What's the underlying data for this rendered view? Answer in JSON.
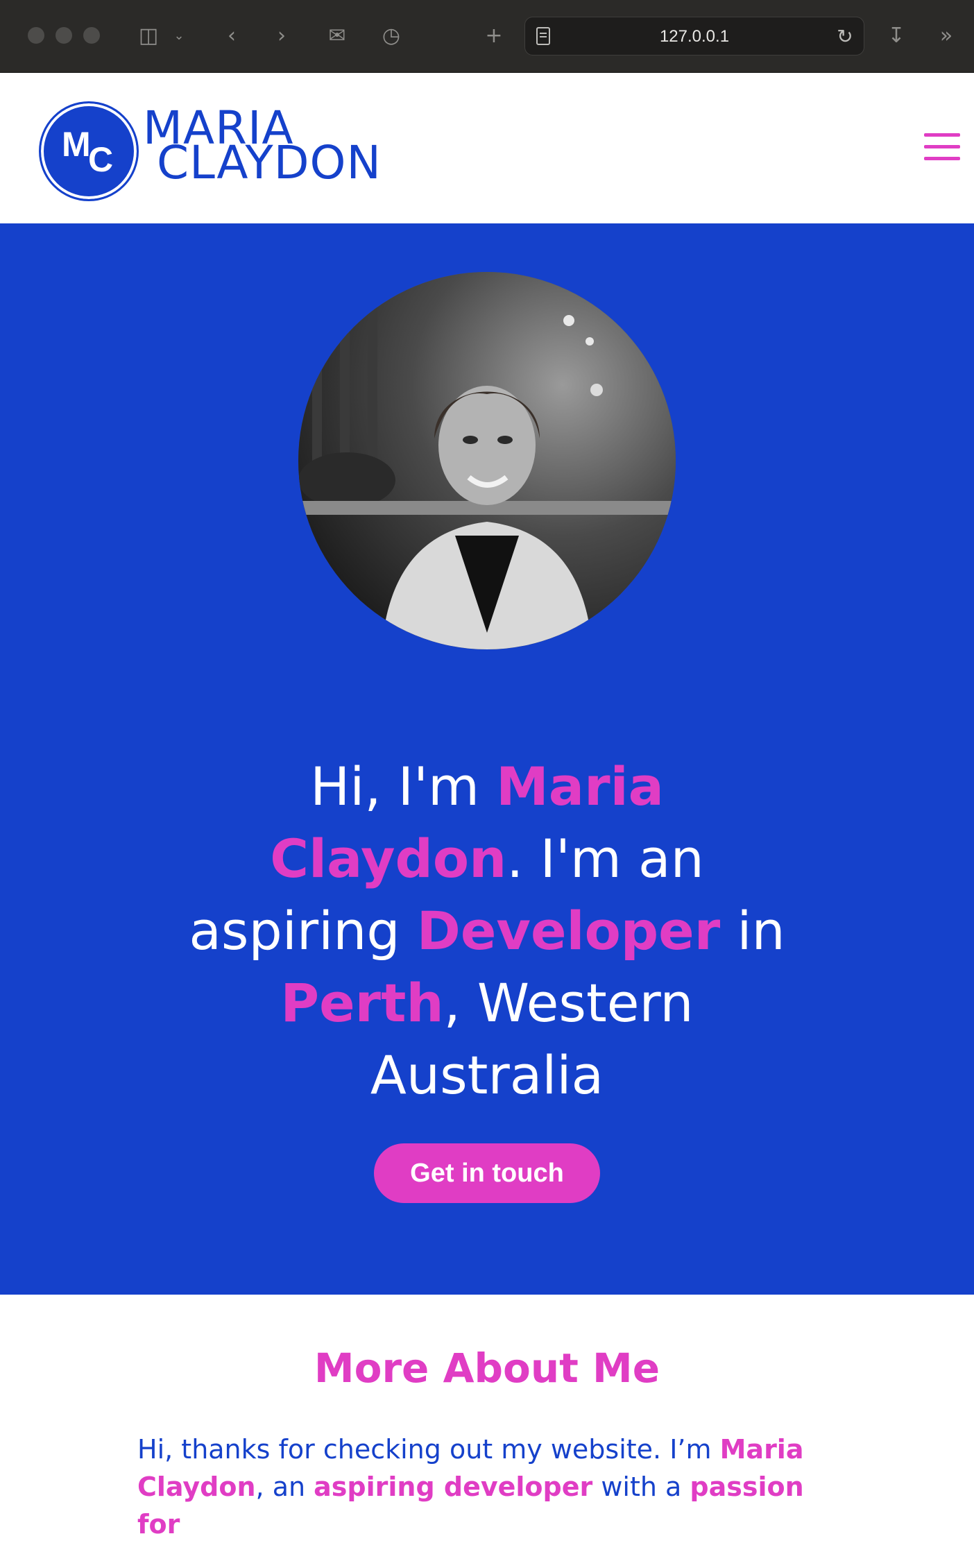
{
  "browser": {
    "url": "127.0.0.1",
    "icons": [
      "sidebar-icon",
      "chevron-down-icon",
      "back-icon",
      "forward-icon",
      "mail-icon",
      "history-icon",
      "new-tab-icon",
      "page-icon",
      "reload-icon",
      "download-icon",
      "overflow-icon"
    ]
  },
  "header": {
    "logo_initial_1": "M",
    "logo_initial_2": "C",
    "logo_line_1": "MARIA",
    "logo_line_2": "CLAYDON",
    "menu_icon": "hamburger-icon"
  },
  "hero": {
    "t1": "Hi, I'm ",
    "name": "Maria Claydon",
    "t2": ". I'm an aspiring ",
    "role": "Developer",
    "t3": " in ",
    "city": "Perth",
    "t4": ", Western Australia",
    "cta_label": "Get in touch"
  },
  "about": {
    "title": "More About Me",
    "t1": "Hi, thanks for checking out my website. I’m ",
    "name": "Maria Claydon",
    "t2": ", an ",
    "role": "aspiring developer",
    "t3": " with a ",
    "passion": "passion for"
  },
  "colors": {
    "brand_blue": "#1541cb",
    "accent_pink": "#e03dc4"
  }
}
